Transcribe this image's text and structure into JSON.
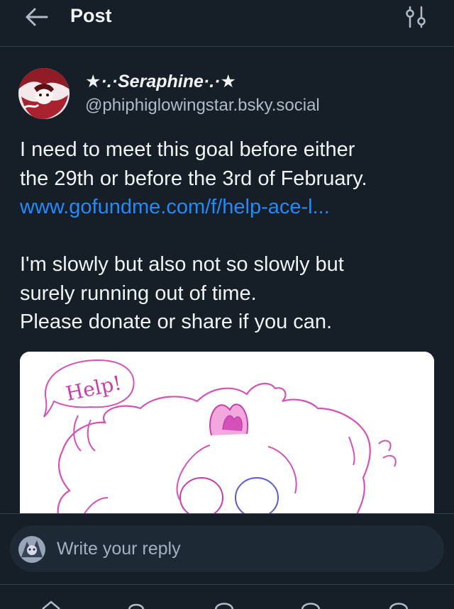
{
  "header": {
    "title": "Post",
    "back_icon": "arrow-left-icon",
    "filter_icon": "sliders-icon"
  },
  "post": {
    "author": {
      "display_name": "★·.·Seraphine·.·★",
      "handle": "@phiphiglowingstar.bsky.social"
    },
    "text_lines": [
      "I need to meet this goal before either",
      "the 29th or before the 3rd of February."
    ],
    "link": "www.gofundme.com/f/help-ace-l...",
    "text_lines_2": [
      "I'm slowly but also not so slowly but",
      "surely running out of time.",
      "Please donate or share if you can."
    ],
    "image": {
      "description_icon": "drawing-image",
      "caption_text": "Help!"
    }
  },
  "reply": {
    "placeholder": "Write your reply"
  },
  "colors": {
    "background": "#161e27",
    "link": "#208bfe",
    "border": "#2e4052",
    "muted": "#aebbc9"
  }
}
